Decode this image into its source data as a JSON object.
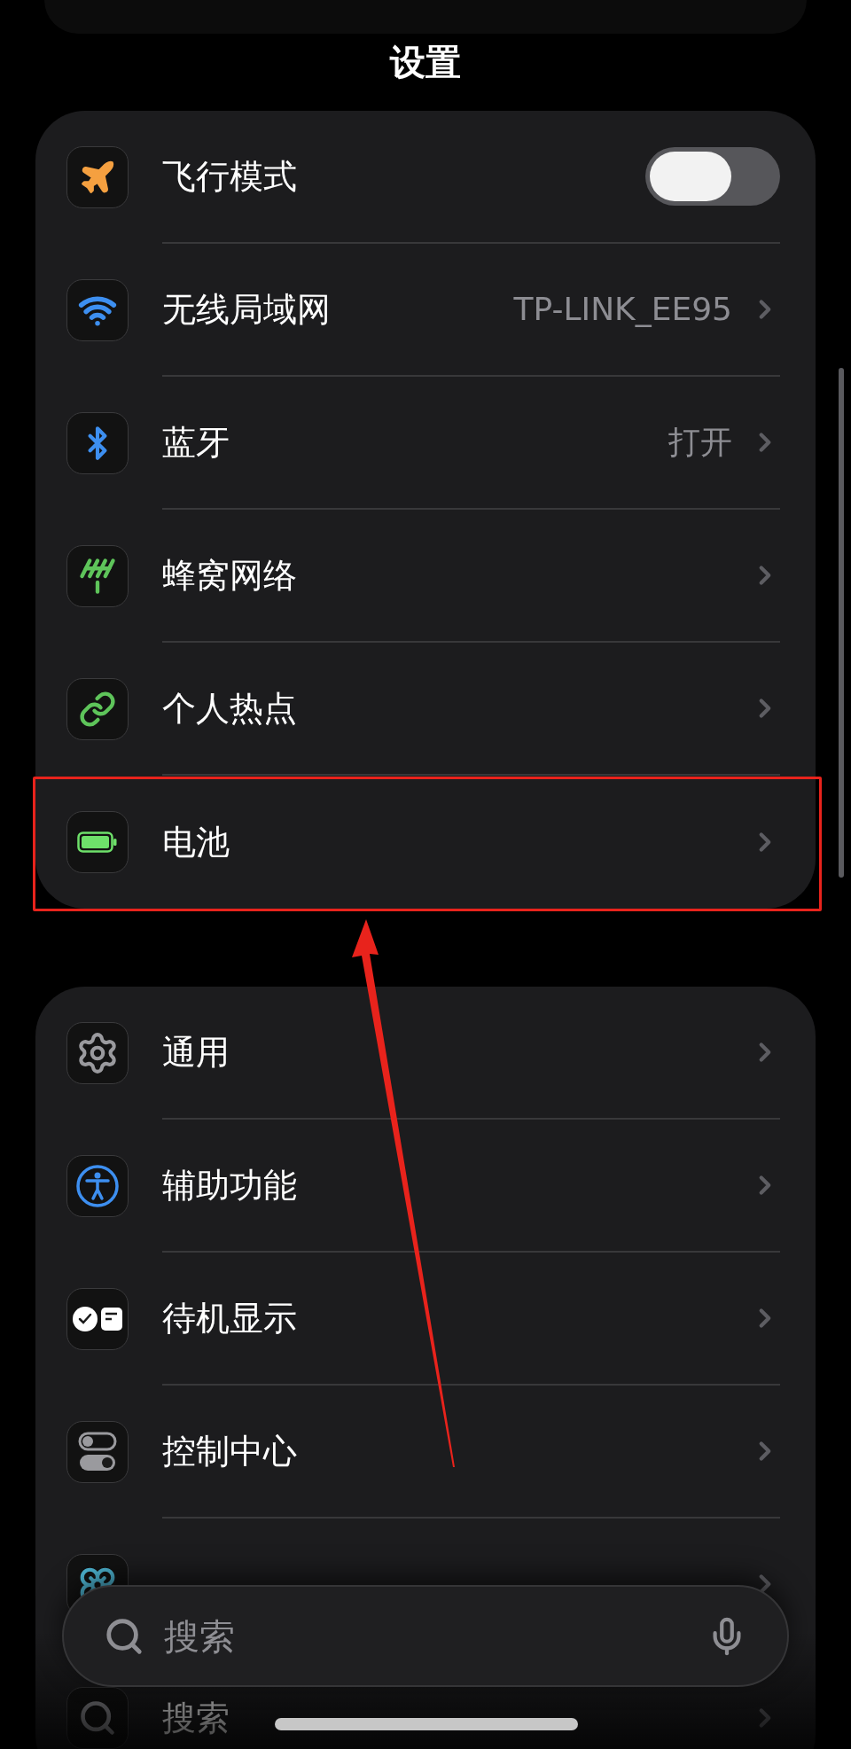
{
  "header": {
    "title": "设置"
  },
  "groups": [
    {
      "rows": [
        {
          "kind": "toggle",
          "label": "飞行模式",
          "on": false,
          "highlighted": false
        },
        {
          "kind": "link",
          "label": "无线局域网",
          "value": "TP-LINK_EE95",
          "highlighted": false
        },
        {
          "kind": "link",
          "label": "蓝牙",
          "value": "打开",
          "highlighted": false
        },
        {
          "kind": "link",
          "label": "蜂窝网络",
          "highlighted": false
        },
        {
          "kind": "link",
          "label": "个人热点",
          "highlighted": false
        },
        {
          "kind": "link",
          "label": "电池",
          "highlighted": true
        }
      ]
    },
    {
      "rows": [
        {
          "kind": "link",
          "label": "通用",
          "highlighted": false
        },
        {
          "kind": "link",
          "label": "辅助功能",
          "highlighted": false
        },
        {
          "kind": "link",
          "label": "待机显示",
          "highlighted": false
        },
        {
          "kind": "link",
          "label": "控制中心",
          "highlighted": false
        },
        {
          "kind": "link",
          "highlighted": false
        },
        {
          "kind": "link",
          "label": "搜索",
          "highlighted": false
        }
      ]
    }
  ],
  "search_bar": {
    "placeholder": "搜索"
  }
}
